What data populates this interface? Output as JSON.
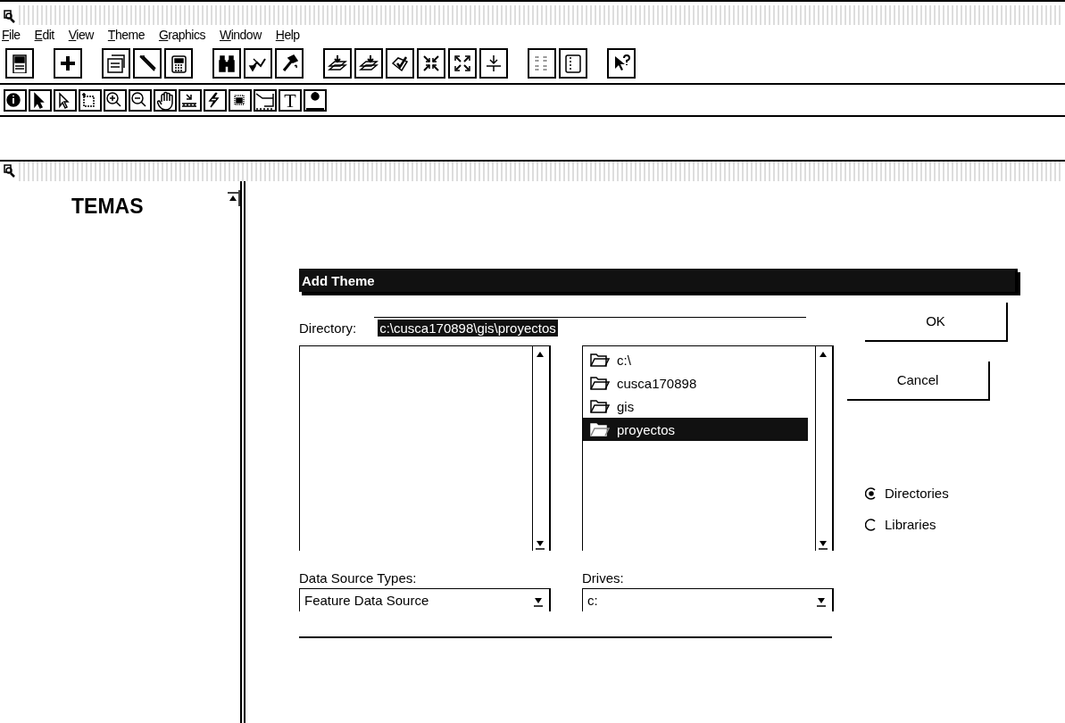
{
  "menu": [
    {
      "label": "File"
    },
    {
      "label": "Edit"
    },
    {
      "label": "View"
    },
    {
      "label": "Theme"
    },
    {
      "label": "Graphics"
    },
    {
      "label": "Window"
    },
    {
      "label": "Help"
    }
  ],
  "text_tool_label": "T",
  "themes_panel": {
    "title": "TEMAS"
  },
  "dialog": {
    "title": "Add Theme",
    "directory_label": "Directory:",
    "directory_value": "c:\\cusca170898\\gis\\proyectos",
    "directory_value_highlighted": true,
    "folders": [
      {
        "name": "c:\\",
        "selected": false
      },
      {
        "name": "cusca170898",
        "selected": false
      },
      {
        "name": "gis",
        "selected": false
      },
      {
        "name": "proyectos",
        "selected": true
      }
    ],
    "buttons": [
      {
        "label": "OK"
      },
      {
        "label": "Cancel"
      }
    ],
    "list_type_options": [
      {
        "label": "Directories",
        "selected": true
      },
      {
        "label": "Libraries",
        "selected": false
      }
    ],
    "data_source_types": {
      "label": "Data Source Types:",
      "value": "Feature Data Source"
    },
    "drives": {
      "label": "Drives:",
      "value": "c:"
    }
  }
}
